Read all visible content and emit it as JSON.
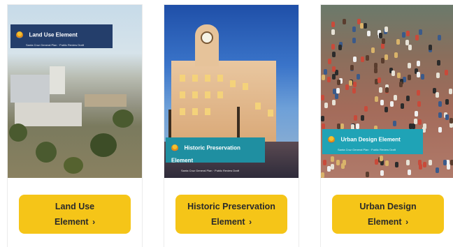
{
  "cards": [
    {
      "cover_title": "Land Use Element",
      "cover_sub": "Santa Cruz General Plan · Public Review Draft",
      "button_line1": "Land Use",
      "button_line2": "Element",
      "chevron": "›"
    },
    {
      "cover_title": "Historic Preservation Element",
      "cover_sub": "Santa Cruz General Plan · Public Review Draft",
      "button_line1": "Historic Preservation",
      "button_line2": "Element",
      "chevron": "›"
    },
    {
      "cover_title": "Urban Design Element",
      "cover_sub": "Santa Cruz General Plan · Public Review Draft",
      "button_line1": "Urban Design",
      "button_line2": "Element",
      "chevron": "›"
    }
  ],
  "colors": {
    "button": "#f5c518",
    "banner_land_use": "#243e6b",
    "banner_historic": "#1f8fa1",
    "banner_urban": "#1fa3b6"
  },
  "icons": [
    "city-logo-icon",
    "chevron-right-icon"
  ]
}
